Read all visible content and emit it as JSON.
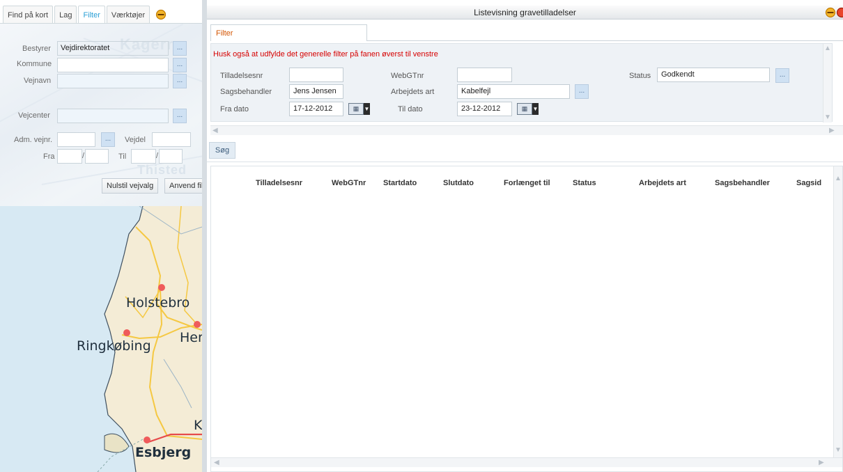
{
  "left_tabs": [
    "Find på kort",
    "Lag",
    "Filter",
    "Værktøjer"
  ],
  "left_filter": {
    "bestyrer_label": "Bestyrer",
    "bestyrer_value": "Vejdirektoratet",
    "kommune_label": "Kommune",
    "vejnavn_label": "Vejnavn",
    "vejcenter_label": "Vejcenter",
    "adm_vejnr_label": "Adm. vejnr.",
    "vejdel_label": "Vejdel",
    "fra_label": "Fra",
    "til_label": "Til",
    "nulstil_button": "Nulstil vejvalg",
    "anvend_button": "Anvend filter",
    "dots": "...",
    "watermark_1": "Kagerra",
    "watermark_2": "Thisted"
  },
  "map": {
    "cities": [
      "Holstebro",
      "Ringkøbing",
      "Her",
      "K",
      "Esbjerg"
    ]
  },
  "window": {
    "title": "Listevisning gravetilladelser"
  },
  "filter_tab": "Filter",
  "warning": "Husk også at udfylde det generelle filter på fanen øverst til venstre",
  "fields": {
    "tilladelsesnr_label": "Tilladelsesnr",
    "tilladelsesnr_value": "",
    "webgtnr_label": "WebGTnr",
    "webgtnr_value": "",
    "status_label": "Status",
    "status_value": "Godkendt",
    "sagsbehandler_label": "Sagsbehandler",
    "sagsbehandler_value": "Jens Jensen",
    "arbejdets_art_label": "Arbejdets art",
    "arbejdets_art_value": "Kabelfejl",
    "fra_dato_label": "Fra dato",
    "fra_dato_value": "17-12-2012",
    "til_dato_label": "Til dato",
    "til_dato_value": "23-12-2012"
  },
  "search_button": "Søg",
  "table": {
    "columns": [
      "Tilladelsesnr",
      "WebGTnr",
      "Startdato",
      "Slutdato",
      "Forlænget til",
      "Status",
      "Arbejdets art",
      "Sagsbehandler",
      "Sagsid"
    ],
    "rows": []
  },
  "colors": {
    "accent_tab": "#2a9fd6",
    "filter_tab_text": "#d35400",
    "warning_text": "#d60000",
    "dots_button_bg": "#cfe1f3",
    "collapse_icon": "#f0a800"
  }
}
